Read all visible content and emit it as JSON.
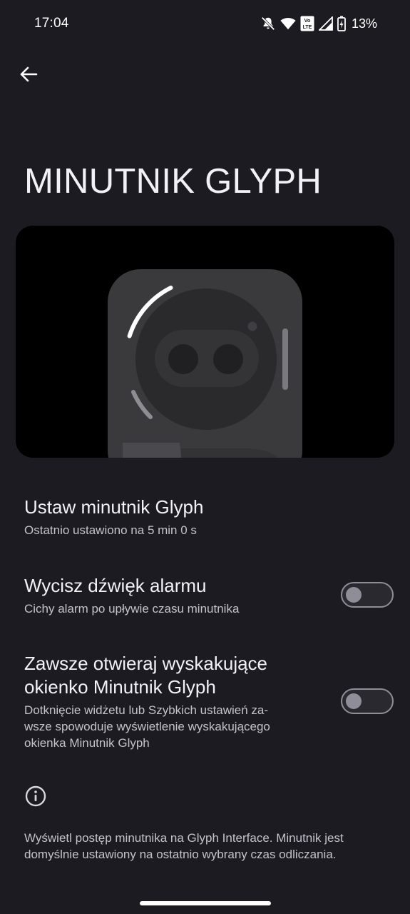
{
  "status_bar": {
    "time": "17:04",
    "battery_percent": "13%",
    "network_badge_top": "Vo",
    "network_badge_bottom": "LTE",
    "icons": [
      "mute-icon",
      "wifi-icon",
      "volte-icon",
      "signal-icon",
      "battery-charging-icon"
    ]
  },
  "header": {
    "back_icon": "arrow-left-icon",
    "title": "MINUTNIK GLYPH"
  },
  "settings": [
    {
      "title": "Ustaw minutnik Glyph",
      "subtitle": "Ostatnio ustawiono na 5 min 0 s"
    },
    {
      "title": "Wycisz dźwięk alarmu",
      "subtitle": "Cichy alarm po upływie czasu minutnika",
      "toggle_on": false
    },
    {
      "title_line1": "Zawsze otwieraj wyskakujące",
      "title_line2": "okienko Minutnik Glyph",
      "subtitle_line1": "Dotknięcie widżetu lub Szybkich ustawień za-",
      "subtitle_line2": "wsze spowoduje wyświetlenie wyskakującego",
      "subtitle_line3": "okienka Minutnik Glyph",
      "toggle_on": false
    }
  ],
  "footer": {
    "info_icon": "info-icon",
    "line1": "Wyświetl postęp minutnika na Glyph Interface. Minutnik jest",
    "line2": "domyślnie ustawiony na ostatnio wybrany czas odliczania."
  },
  "colors": {
    "background": "#1c1b21",
    "text_primary": "#f2f1f6",
    "text_secondary": "#c4c3cc",
    "toggle_off": "#8f8e98"
  }
}
